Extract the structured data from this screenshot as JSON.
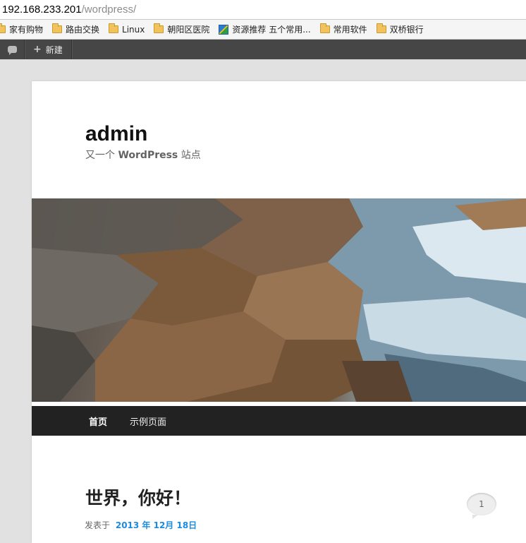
{
  "browser": {
    "url_host": "192.168.233.201",
    "url_path": "/wordpress/"
  },
  "bookmarks": [
    {
      "label": "家有购物",
      "icon": "folder-icon"
    },
    {
      "label": "路由交换",
      "icon": "folder-icon"
    },
    {
      "label": "Linux",
      "icon": "folder-icon"
    },
    {
      "label": "朝阳区医院",
      "icon": "folder-icon"
    },
    {
      "label": "资源推荐 五个常用...",
      "icon": "site-icon"
    },
    {
      "label": "常用软件",
      "icon": "folder-icon"
    },
    {
      "label": "双桥银行",
      "icon": "folder-icon"
    }
  ],
  "adminbar": {
    "comments_icon": "comment-bubble-icon",
    "new_label": "新建"
  },
  "site": {
    "title": "admin",
    "description_prefix": "又一个",
    "description_brand": "WordPress",
    "description_suffix": "站点"
  },
  "nav": {
    "items": [
      "首页",
      "示例页面"
    ]
  },
  "post": {
    "title": "世界，你好！",
    "meta_prefix": "发表于",
    "date": "2013 年 12月 18日",
    "comment_count": "1"
  },
  "colors": {
    "link": "#1b8be0",
    "adminbar": "#464646",
    "navbar": "#222222"
  }
}
